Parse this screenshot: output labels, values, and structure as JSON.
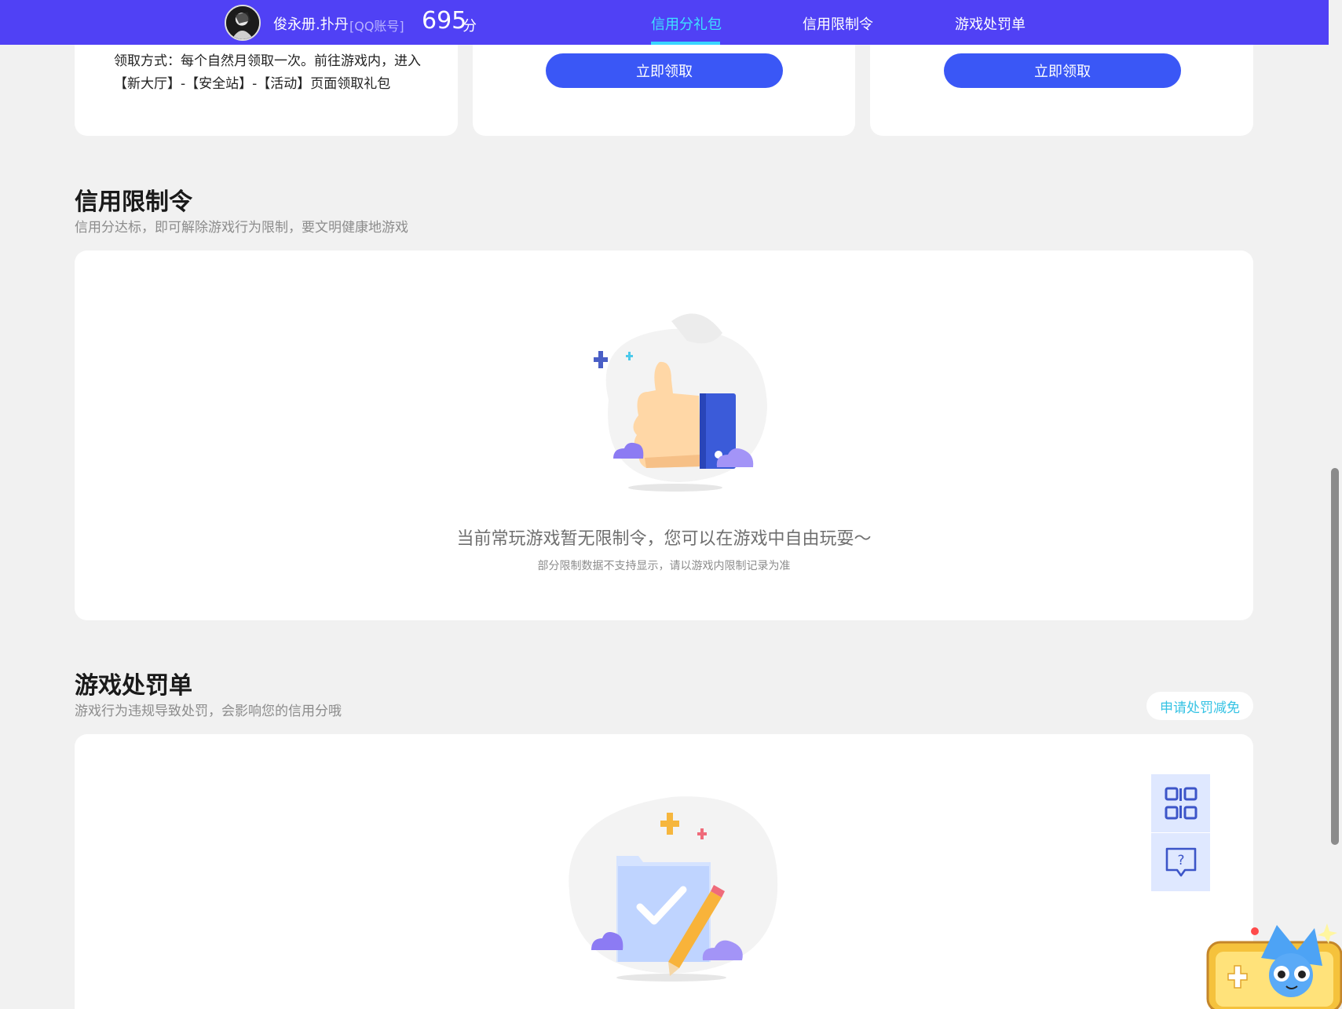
{
  "header": {
    "username": "俊永册.扑丹",
    "account_type": "[QQ账号]",
    "score": "695",
    "score_unit": "分",
    "tabs": [
      {
        "label": "信用分礼包",
        "active": true
      },
      {
        "label": "信用限制令",
        "active": false
      },
      {
        "label": "游戏处罚单",
        "active": false
      }
    ]
  },
  "gift_section": {
    "claim_method": "领取方式：每个自然月领取一次。前往游戏内，进入【新大厅】-【安全站】-【活动】页面领取礼包",
    "claim_button": "立即领取"
  },
  "restriction_section": {
    "title": "信用限制令",
    "subtitle": "信用分达标，即可解除游戏行为限制，要文明健康地游戏",
    "empty_main": "当前常玩游戏暂无限制令，您可以在游戏中自由玩耍～",
    "empty_sub": "部分限制数据不支持显示，请以游戏内限制记录为准"
  },
  "penalty_section": {
    "title": "游戏处罚单",
    "subtitle": "游戏行为违规导致处罚，会影响您的信用分哦",
    "appeal_button": "申请处罚减免"
  },
  "float_tool": {
    "items": [
      "qrcode-icon",
      "help-chat-icon"
    ]
  },
  "colors": {
    "nav_bg": "#5041f5",
    "active_tab": "#3ee3ff",
    "button": "#3a57f6",
    "page_bg": "#f1f1f1",
    "appeal_text": "#36c3e4"
  }
}
